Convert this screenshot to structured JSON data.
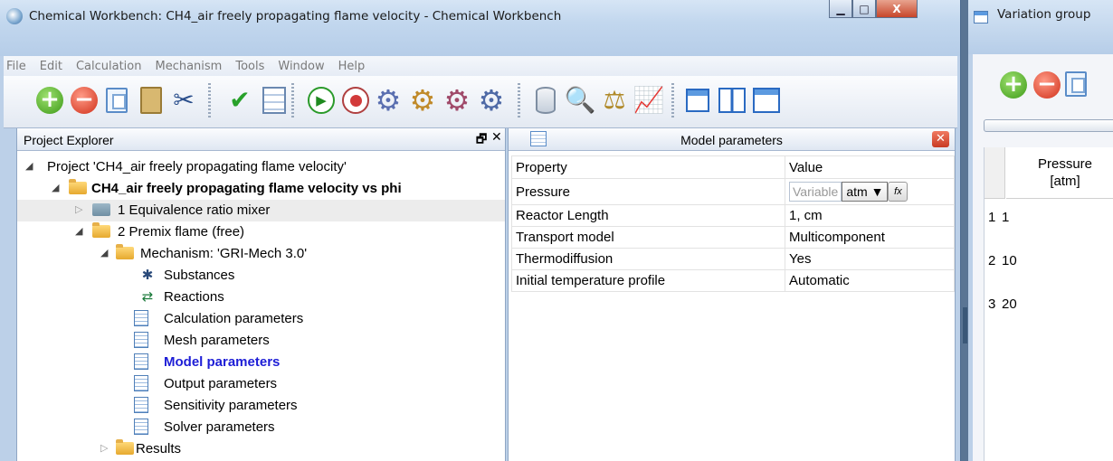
{
  "main_window": {
    "title": "Chemical Workbench: CH4_air freely propagating flame velocity - Chemical Workbench",
    "buttons": {
      "minimize": "▁",
      "maximize": "□",
      "close": "X"
    }
  },
  "menu": [
    "File",
    "Edit",
    "Calculation",
    "Mechanism",
    "Tools",
    "Window",
    "Help"
  ],
  "toolbar": {
    "icons": [
      "add-icon",
      "remove-icon",
      "copy-icon",
      "paste-icon",
      "cut-icon",
      "check-icon",
      "form-icon",
      "run-icon",
      "stop-icon",
      "gear-add-icon",
      "gear-multi-icon",
      "gear-remove-icon",
      "gear-icon",
      "database-icon",
      "search-database-icon",
      "scales-icon",
      "chart-icon",
      "cascade-windows-icon",
      "tile-windows-icon",
      "window-icon"
    ]
  },
  "project_explorer": {
    "title": "Project Explorer",
    "pin_glyph": "🗗",
    "close_glyph": "✕",
    "tree": [
      {
        "label": "Project 'CH4_air freely propagating flame velocity'"
      },
      {
        "label": "CH4_air freely propagating flame velocity vs phi"
      },
      {
        "label": "1 Equivalence ratio mixer"
      },
      {
        "label": "2 Premix flame (free)"
      },
      {
        "label": "Mechanism: 'GRI-Mech 3.0'"
      },
      {
        "label": "Substances"
      },
      {
        "label": "Reactions"
      },
      {
        "label": "Calculation parameters"
      },
      {
        "label": "Mesh parameters"
      },
      {
        "label": "Model parameters"
      },
      {
        "label": "Output parameters"
      },
      {
        "label": "Sensitivity parameters"
      },
      {
        "label": "Solver parameters"
      },
      {
        "label": "Results"
      }
    ]
  },
  "model_parameters": {
    "title": "Model parameters",
    "columns": {
      "property": "Property",
      "value": "Value"
    },
    "pressure": {
      "property": "Pressure",
      "variable": "Variable",
      "unit": "atm",
      "fx": "fx"
    },
    "rows": [
      {
        "property": "Reactor Length",
        "value": "1, cm"
      },
      {
        "property": "Transport model",
        "value": "Multicomponent"
      },
      {
        "property": "Thermodiffusion",
        "value": "Yes"
      },
      {
        "property": "Initial temperature profile",
        "value": "Automatic"
      }
    ]
  },
  "variation_window": {
    "title": "Variation group",
    "column_header_line1": "Pressure",
    "column_header_line2": "[atm]",
    "rows": [
      {
        "num": "1",
        "value": "1"
      },
      {
        "num": "2",
        "value": "10"
      },
      {
        "num": "3",
        "value": "20"
      }
    ]
  }
}
